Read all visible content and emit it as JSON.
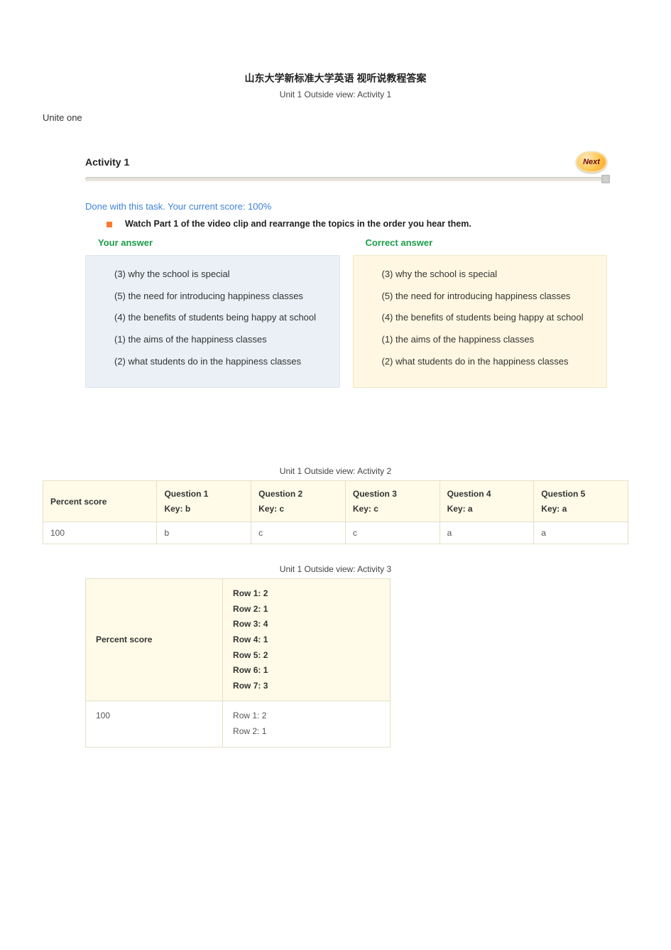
{
  "header": {
    "title": "山东大学新标准大学英语 视听说教程答案",
    "subtitle": "Unit 1 Outside view: Activity 1",
    "unite_label": "Unite one"
  },
  "activity1": {
    "title": "Activity 1",
    "next_label": "Next",
    "score_line": "Done with this task. Your current score: 100%",
    "instruction": "Watch Part 1 of the video clip and rearrange the topics in the order you hear them.",
    "your_header": "Your answer",
    "correct_header": "Correct answer",
    "your_items": [
      "(3) why the school is special",
      "(5) the need for introducing happiness classes",
      "(4) the benefits of students being happy at school",
      "(1) the aims of the happiness classes",
      "(2) what students do in the happiness classes"
    ],
    "correct_items": [
      "(3) why the school is special",
      "(5) the need for introducing happiness classes",
      "(4) the benefits of students being happy at school",
      "(1) the aims of the happiness classes",
      "(2) what students do in the happiness classes"
    ]
  },
  "activity2": {
    "caption": "Unit 1 Outside view: Activity 2",
    "col0": "Percent score",
    "headers": [
      {
        "q": "Question 1",
        "k": "Key: b"
      },
      {
        "q": "Question 2",
        "k": "Key: c"
      },
      {
        "q": "Question 3",
        "k": "Key: c"
      },
      {
        "q": "Question 4",
        "k": "Key: a"
      },
      {
        "q": "Question 5",
        "k": "Key: a"
      }
    ],
    "row": {
      "score": "100",
      "answers": [
        "b",
        "c",
        "c",
        "a",
        "a"
      ]
    }
  },
  "activity3": {
    "caption": "Unit 1 Outside view: Activity 3",
    "col0": "Percent score",
    "key_rows": [
      "Row 1: 2",
      "Row 2: 1",
      "Row 3: 4",
      "Row 4: 1",
      "Row 5: 2",
      "Row 6: 1",
      "Row 7: 3"
    ],
    "body": {
      "score": "100",
      "rows": [
        "Row 1: 2",
        "Row 2: 1"
      ]
    }
  }
}
